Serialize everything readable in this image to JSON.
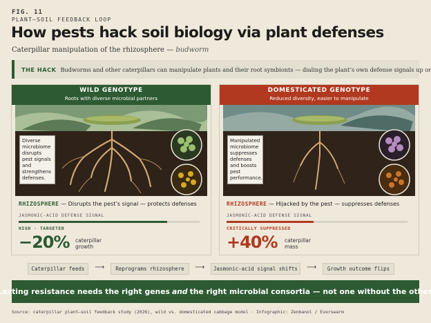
{
  "header": {
    "fig_label": "FIG. 11",
    "kicker": "PLANT–SOIL FEEDBACK LOOP",
    "title": "How pests hack soil biology via plant defenses",
    "subtitle_main": "Caterpillar manipulation of the rhizosphere —",
    "subtitle_italic": "budworm"
  },
  "hack": {
    "label": "THE HACK",
    "text": "Budworms and other caterpillars can manipulate plants and their root symbionts — dialing the plant’s own defense signals up or down."
  },
  "wild": {
    "title": "WILD GENOTYPE",
    "subtitle": "Roots with diverse microbial partners",
    "note": "Diverse microbiome disrupts pest signals and strengthens defenses.",
    "zone_label": "RHIZOSPHERE",
    "zone_text": "— Disrupts the pest’s signal — protects defenses",
    "signal_label": "JASMONIC-ACID DEFENSE SIGNAL",
    "signal_level": 0.82,
    "level_text": "HIGH · TARGETED",
    "big_value": "−20%",
    "big_caption_1": "caterpillar",
    "big_caption_2": "growth",
    "accent": "#2d5a32"
  },
  "domesticated": {
    "title": "DOMESTICATED GENOTYPE",
    "subtitle": "Reduced diversity, easier to manipulate",
    "note": "Manipulated microbiome suppresses defenses and boosts pest performance.",
    "zone_label": "RHIZOSPHERE",
    "zone_text": "— Hijacked by the pest — suppresses defenses",
    "signal_label": "JASMONIC-ACID DEFENSE SIGNAL",
    "signal_level": 0.48,
    "level_text": "CRITICALLY SUPPRESSED",
    "big_value": "+40%",
    "big_caption_1": "caterpillar",
    "big_caption_2": "mass",
    "accent": "#b0391f"
  },
  "steps": [
    {
      "label": "Caterpillar feeds"
    },
    {
      "label": "Reprograms rhizosphere"
    },
    {
      "label": "Jasmonic-acid signal shifts"
    },
    {
      "label": "Growth outcome flips"
    }
  ],
  "footer": {
    "part1": "Lasting resistance needs the right genes",
    "italic": "and",
    "part2": "the right microbial consortia — not one without the other."
  },
  "source": "Source: caterpillar plant–soil feedback study (2026), wild vs. domesticated cabbage model · Infographic: Zenbanol / Everswarm"
}
